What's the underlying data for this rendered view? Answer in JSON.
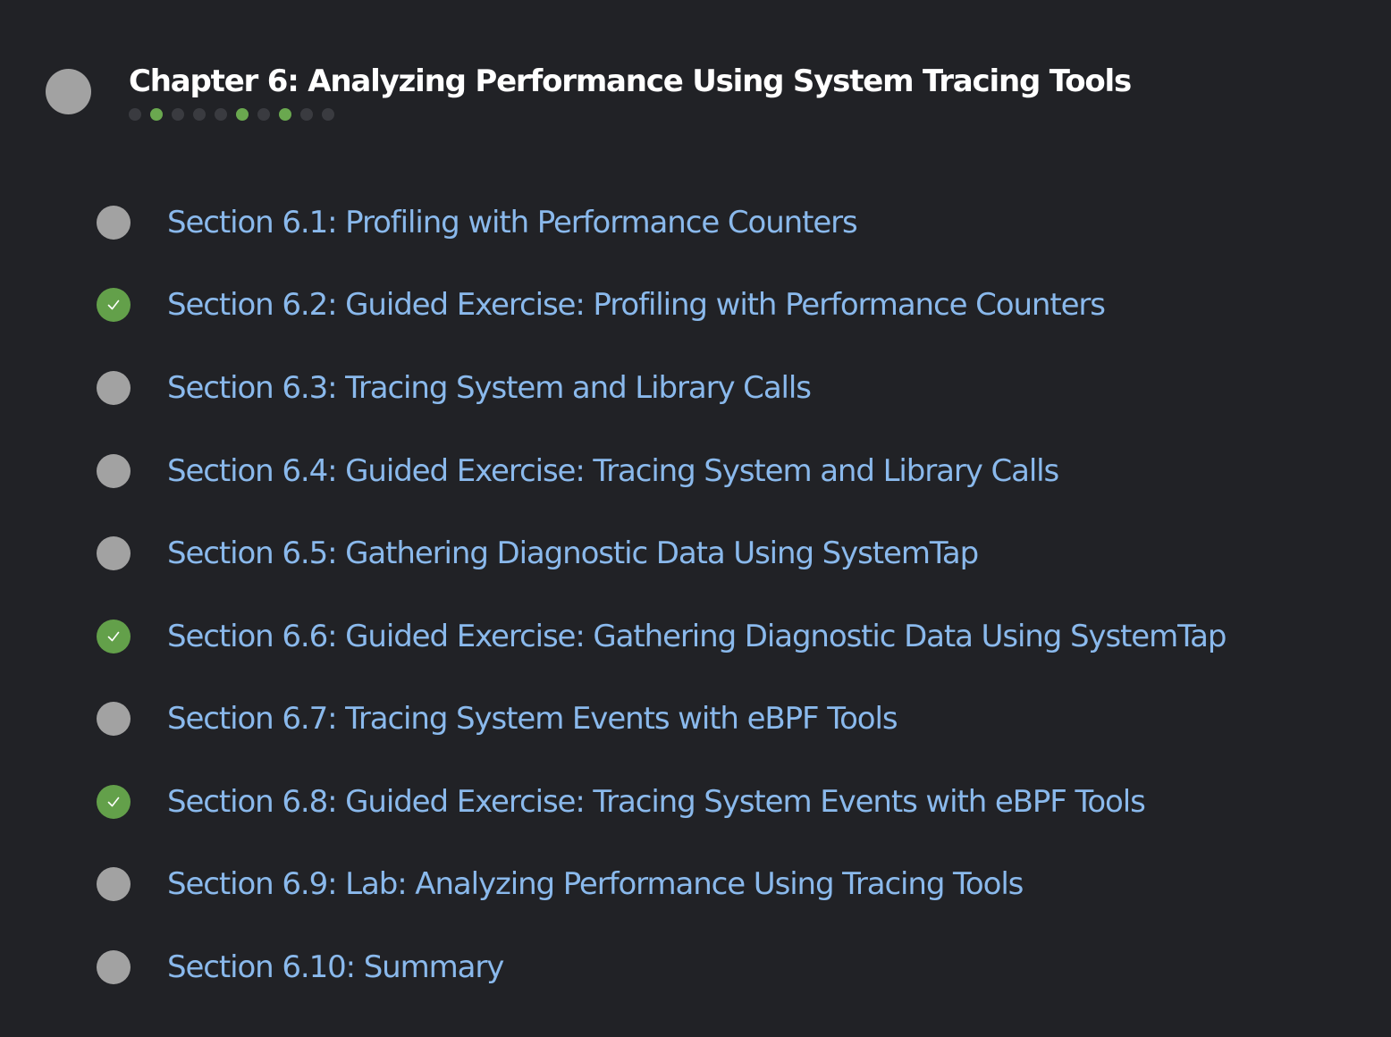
{
  "chapter": {
    "title": "Chapter 6: Analyzing Performance Using System Tracing Tools",
    "progress_dots": [
      false,
      true,
      false,
      false,
      false,
      true,
      false,
      true,
      false,
      false
    ]
  },
  "sections": [
    {
      "label": "Section 6.1: Profiling with Performance Counters",
      "complete": false
    },
    {
      "label": "Section 6.2: Guided Exercise: Profiling with Performance Counters",
      "complete": true
    },
    {
      "label": "Section 6.3: Tracing System and Library Calls",
      "complete": false
    },
    {
      "label": "Section 6.4: Guided Exercise: Tracing System and Library Calls",
      "complete": false
    },
    {
      "label": "Section 6.5: Gathering Diagnostic Data Using SystemTap",
      "complete": false
    },
    {
      "label": "Section 6.6: Guided Exercise: Gathering Diagnostic Data Using SystemTap",
      "complete": true
    },
    {
      "label": "Section 6.7: Tracing System Events with eBPF Tools",
      "complete": false
    },
    {
      "label": "Section 6.8: Guided Exercise: Tracing System Events with eBPF Tools",
      "complete": true
    },
    {
      "label": "Section 6.9: Lab: Analyzing Performance Using Tracing Tools",
      "complete": false
    },
    {
      "label": "Section 6.10: Summary",
      "complete": false
    }
  ],
  "colors": {
    "background": "#212226",
    "link": "#8ab9ec",
    "complete": "#63a04a",
    "incomplete": "#a2a2a2"
  }
}
